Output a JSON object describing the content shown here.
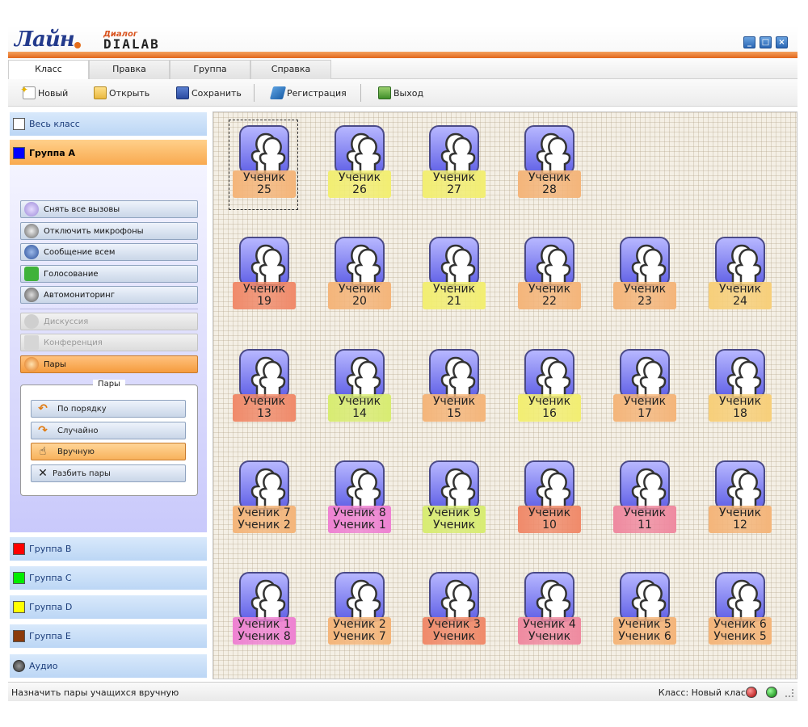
{
  "window": {
    "logo_text": "Лайн",
    "brand_top": "Диалог",
    "brand_main": "DIALAB",
    "min_glyph": "_",
    "max_glyph": "□",
    "close_glyph": "×"
  },
  "menu": {
    "tabs": [
      "Класс",
      "Правка",
      "Группа",
      "Справка"
    ],
    "active": "Класс"
  },
  "toolbar": {
    "new_label": "Новый",
    "open_label": "Открыть",
    "save_label": "Сохранить",
    "register_label": "Регистрация",
    "exit_label": "Выход"
  },
  "sidebar": {
    "whole_class": {
      "label": "Весь класс",
      "color": "#ffffff"
    },
    "group_a": {
      "label": "Группа A",
      "color": "#0000ff"
    },
    "actions": [
      {
        "label": "Снять все вызовы",
        "icon": "phone-icon",
        "state": "normal"
      },
      {
        "label": "Отключить микрофоны",
        "icon": "microphone-icon",
        "state": "normal"
      },
      {
        "label": "Сообщение всем",
        "icon": "message-icon",
        "state": "normal"
      },
      {
        "label": "Голосование",
        "icon": "vote-icon",
        "state": "normal"
      },
      {
        "label": "Автомониторинг",
        "icon": "headset-icon",
        "state": "normal"
      },
      {
        "label": "Дискуссия",
        "icon": "discussion-icon",
        "state": "disabled"
      },
      {
        "label": "Конференция",
        "icon": "conference-icon",
        "state": "disabled"
      },
      {
        "label": "Пары",
        "icon": "pairs-icon",
        "state": "active"
      }
    ],
    "pairs_panel": {
      "title": "Пары",
      "buttons": [
        {
          "label": "По порядку",
          "icon": "order-icon",
          "state": "normal"
        },
        {
          "label": "Случайно",
          "icon": "random-icon",
          "state": "normal"
        },
        {
          "label": "Вручную",
          "icon": "hand-icon",
          "state": "active"
        },
        {
          "label": "Разбить пары",
          "icon": "break-icon",
          "state": "normal"
        }
      ]
    },
    "groups": [
      {
        "label": "Группа B",
        "color": "#ff0000"
      },
      {
        "label": "Группа C",
        "color": "#00ee00"
      },
      {
        "label": "Группа D",
        "color": "#ffff00"
      },
      {
        "label": "Группа E",
        "color": "#8b3a0a"
      }
    ],
    "audio": {
      "label": "Аудио"
    }
  },
  "students": [
    {
      "line1": "Ученик",
      "line2": "25",
      "color": "#f4b57a",
      "selected": true
    },
    {
      "line1": "Ученик",
      "line2": "26",
      "color": "#f2ee72"
    },
    {
      "line1": "Ученик",
      "line2": "27",
      "color": "#f2ee72"
    },
    {
      "line1": "Ученик",
      "line2": "28",
      "color": "#f4b57a"
    },
    {
      "line1": "Ученик",
      "line2": "19",
      "color": "#f08a6a"
    },
    {
      "line1": "Ученик",
      "line2": "20",
      "color": "#f4b57a"
    },
    {
      "line1": "Ученик",
      "line2": "21",
      "color": "#f2ee72"
    },
    {
      "line1": "Ученик",
      "line2": "22",
      "color": "#f4b57a"
    },
    {
      "line1": "Ученик",
      "line2": "23",
      "color": "#f4b57a"
    },
    {
      "line1": "Ученик",
      "line2": "24",
      "color": "#f7cf7a"
    },
    {
      "line1": "Ученик",
      "line2": "13",
      "color": "#f08a6a"
    },
    {
      "line1": "Ученик",
      "line2": "14",
      "color": "#d8ec72"
    },
    {
      "line1": "Ученик",
      "line2": "15",
      "color": "#f4b57a"
    },
    {
      "line1": "Ученик",
      "line2": "16",
      "color": "#f2ee72"
    },
    {
      "line1": "Ученик",
      "line2": "17",
      "color": "#f4b57a"
    },
    {
      "line1": "Ученик",
      "line2": "18",
      "color": "#f7cf7a"
    },
    {
      "line1": "Ученик 7",
      "line2": "Ученик 2",
      "color": "#f4b57a"
    },
    {
      "line1": "Ученик 8",
      "line2": "Ученик 1",
      "color": "#ee82d2"
    },
    {
      "line1": "Ученик 9",
      "line2": "Ученик",
      "color": "#d8ec72"
    },
    {
      "line1": "Ученик",
      "line2": "10",
      "color": "#f08a6a"
    },
    {
      "line1": "Ученик",
      "line2": "11",
      "color": "#ef8aa0"
    },
    {
      "line1": "Ученик",
      "line2": "12",
      "color": "#f4b57a"
    },
    {
      "line1": "Ученик 1",
      "line2": "Ученик 8",
      "color": "#ee82d2"
    },
    {
      "line1": "Ученик 2",
      "line2": "Ученик 7",
      "color": "#f4b57a"
    },
    {
      "line1": "Ученик 3",
      "line2": "Ученик",
      "color": "#f08a6a"
    },
    {
      "line1": "Ученик 4",
      "line2": "Ученик",
      "color": "#ef8aa0"
    },
    {
      "line1": "Ученик 5",
      "line2": "Ученик 6",
      "color": "#f4b57a"
    },
    {
      "line1": "Ученик 6",
      "line2": "Ученик 5",
      "color": "#f4b57a"
    }
  ],
  "status": {
    "left": "Назначить пары учащихся вручную",
    "right": "Класс: Новый класс"
  }
}
